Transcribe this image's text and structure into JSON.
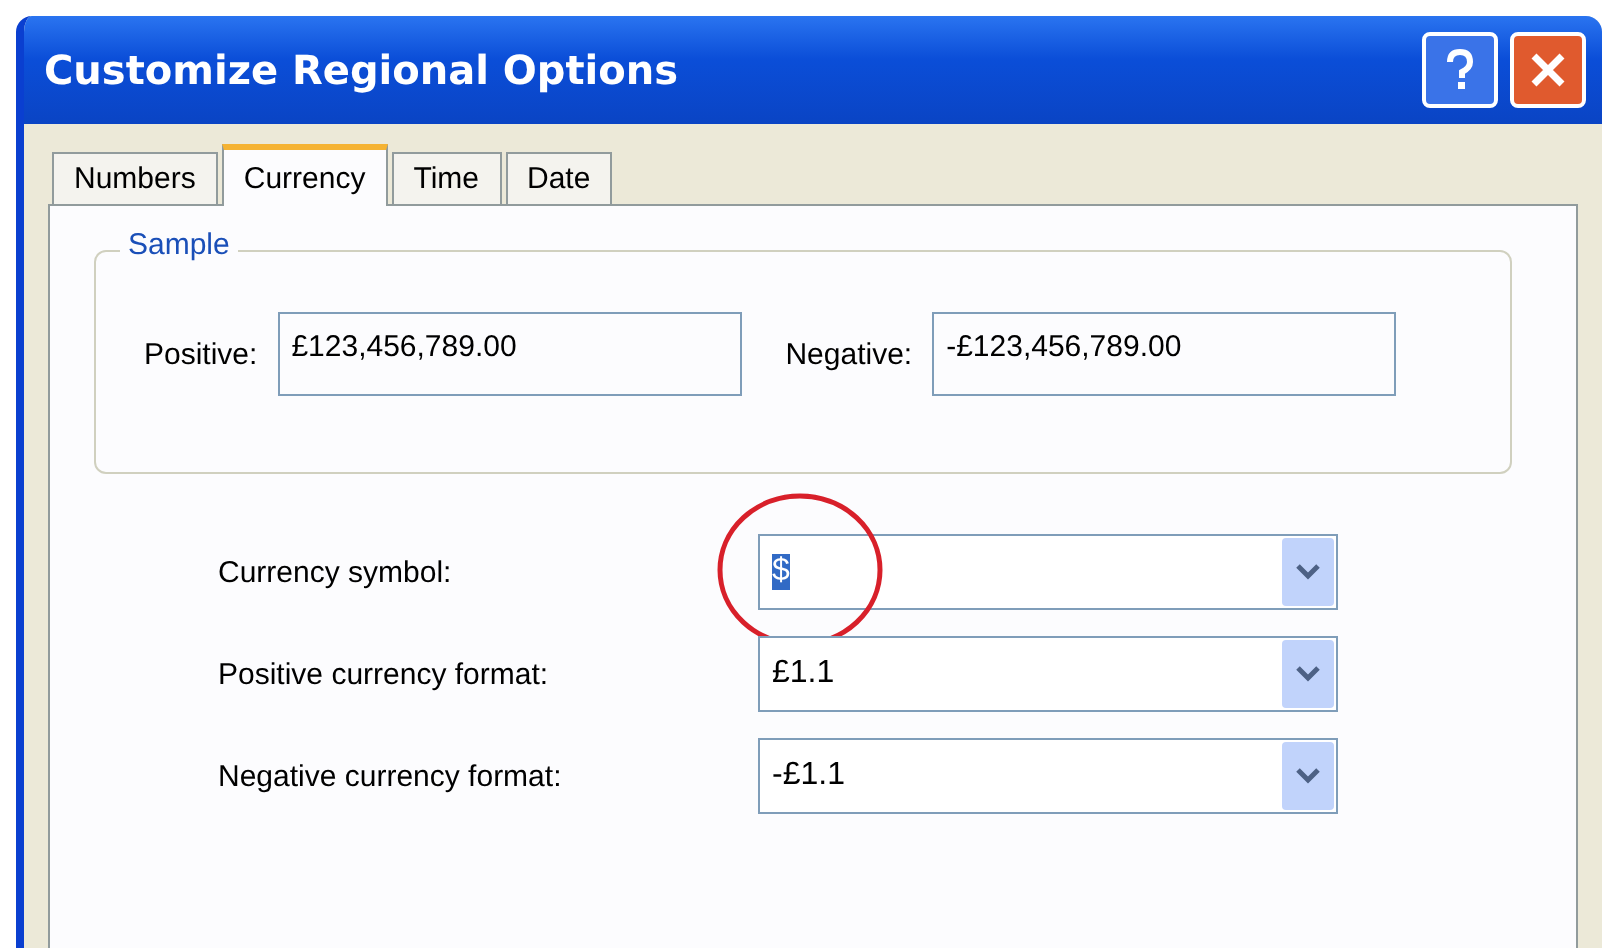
{
  "window": {
    "title": "Customize Regional Options"
  },
  "tabs": [
    {
      "label": "Numbers",
      "selected": false
    },
    {
      "label": "Currency",
      "selected": true
    },
    {
      "label": "Time",
      "selected": false
    },
    {
      "label": "Date",
      "selected": false
    }
  ],
  "sample": {
    "title": "Sample",
    "positive_label": "Positive:",
    "positive_value": "£123,456,789.00",
    "negative_label": "Negative:",
    "negative_value": "-£123,456,789.00"
  },
  "settings": [
    {
      "label": "Currency symbol:",
      "value": "$",
      "text_selected": true,
      "circled": true
    },
    {
      "label": "Positive currency format:",
      "value": "£1.1",
      "text_selected": false,
      "circled": false
    },
    {
      "label": "Negative currency format:",
      "value": "-£1.1",
      "text_selected": false,
      "circled": false
    }
  ]
}
